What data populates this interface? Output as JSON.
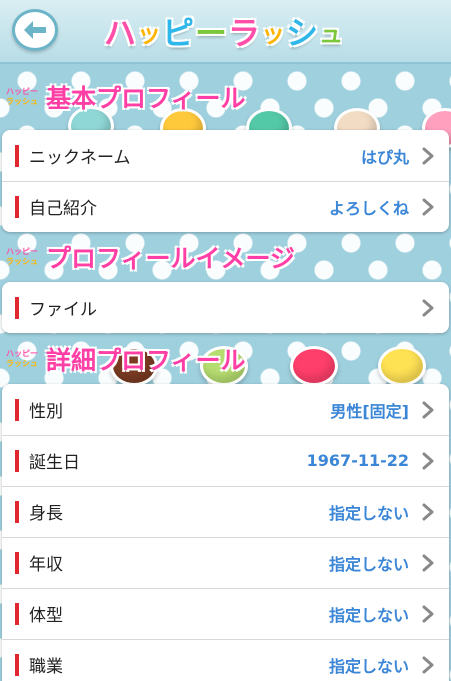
{
  "header": {
    "brand": [
      "ハ",
      "ッ",
      "ピ",
      "ー",
      "ラ",
      "ッ",
      "シ",
      "ュ"
    ],
    "brand_colors": [
      "#ff4fa8",
      "#ffb400",
      "#30b7ea",
      "#7cc83c",
      "#ff4fa8",
      "#ffb400",
      "#30b7ea",
      "#7cc83c"
    ]
  },
  "mini_logo": {
    "line1": "ハッピー",
    "line2": "ラッシュ"
  },
  "sections": {
    "basic": {
      "title": "基本プロフィール",
      "rows": [
        {
          "label": "ニックネーム",
          "value": "はぴ丸"
        },
        {
          "label": "自己紹介",
          "value": "よろしくね"
        }
      ]
    },
    "image": {
      "title": "プロフィールイメージ",
      "rows": [
        {
          "label": "ファイル",
          "value": ""
        }
      ]
    },
    "detail": {
      "title": "詳細プロフィール",
      "rows": [
        {
          "label": "性別",
          "value": "男性[固定]"
        },
        {
          "label": "誕生日",
          "value": "1967-11-22"
        },
        {
          "label": "身長",
          "value": "指定しない"
        },
        {
          "label": "年収",
          "value": "指定しない"
        },
        {
          "label": "体型",
          "value": "指定しない"
        },
        {
          "label": "職業",
          "value": "指定しない"
        }
      ]
    }
  },
  "colors": {
    "accent_pink": "#ff3fa5",
    "value_blue": "#3b86d6",
    "row_bar_red": "#e0262e",
    "background": "#9fd0de"
  }
}
